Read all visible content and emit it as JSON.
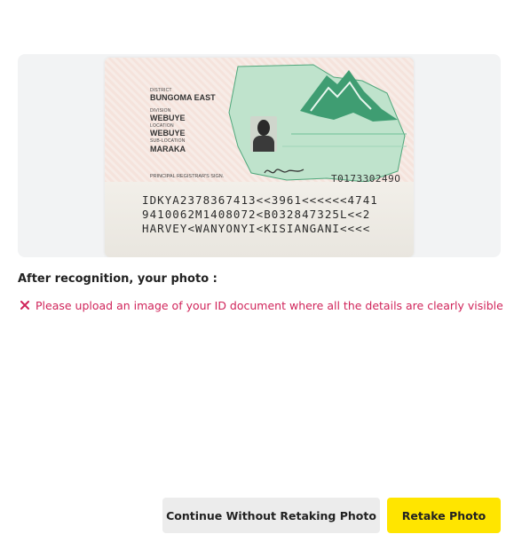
{
  "id_card": {
    "district_label": "DISTRICT",
    "district": "BUNGOMA EAST",
    "division_label": "DIVISION",
    "division": "WEBUYE",
    "location_label": "LOCATION",
    "location": "WEBUYE",
    "sublocation_label": "SUB-LOCATION",
    "sublocation": "MARAKA",
    "signature_label": "PRINCIPAL REGISTRAR'S SIGN.",
    "serial": "T017330249O",
    "mrz_line1": "IDKYA2378367413<<3961<<<<<<4741",
    "mrz_line2": "9410062M1408072<B032847325L<<2",
    "mrz_line3": "HARVEY<WANYONYI<KISIANGANI<<<<"
  },
  "result": {
    "heading": "After recognition, your photo :",
    "error_message": "Please upload an image of your ID document where all the details are clearly visible"
  },
  "actions": {
    "continue_label": "Continue Without Retaking Photo",
    "retake_label": "Retake Photo"
  },
  "colors": {
    "error": "#d0245a",
    "primary_button": "#ffe500",
    "secondary_button": "#ececec"
  }
}
